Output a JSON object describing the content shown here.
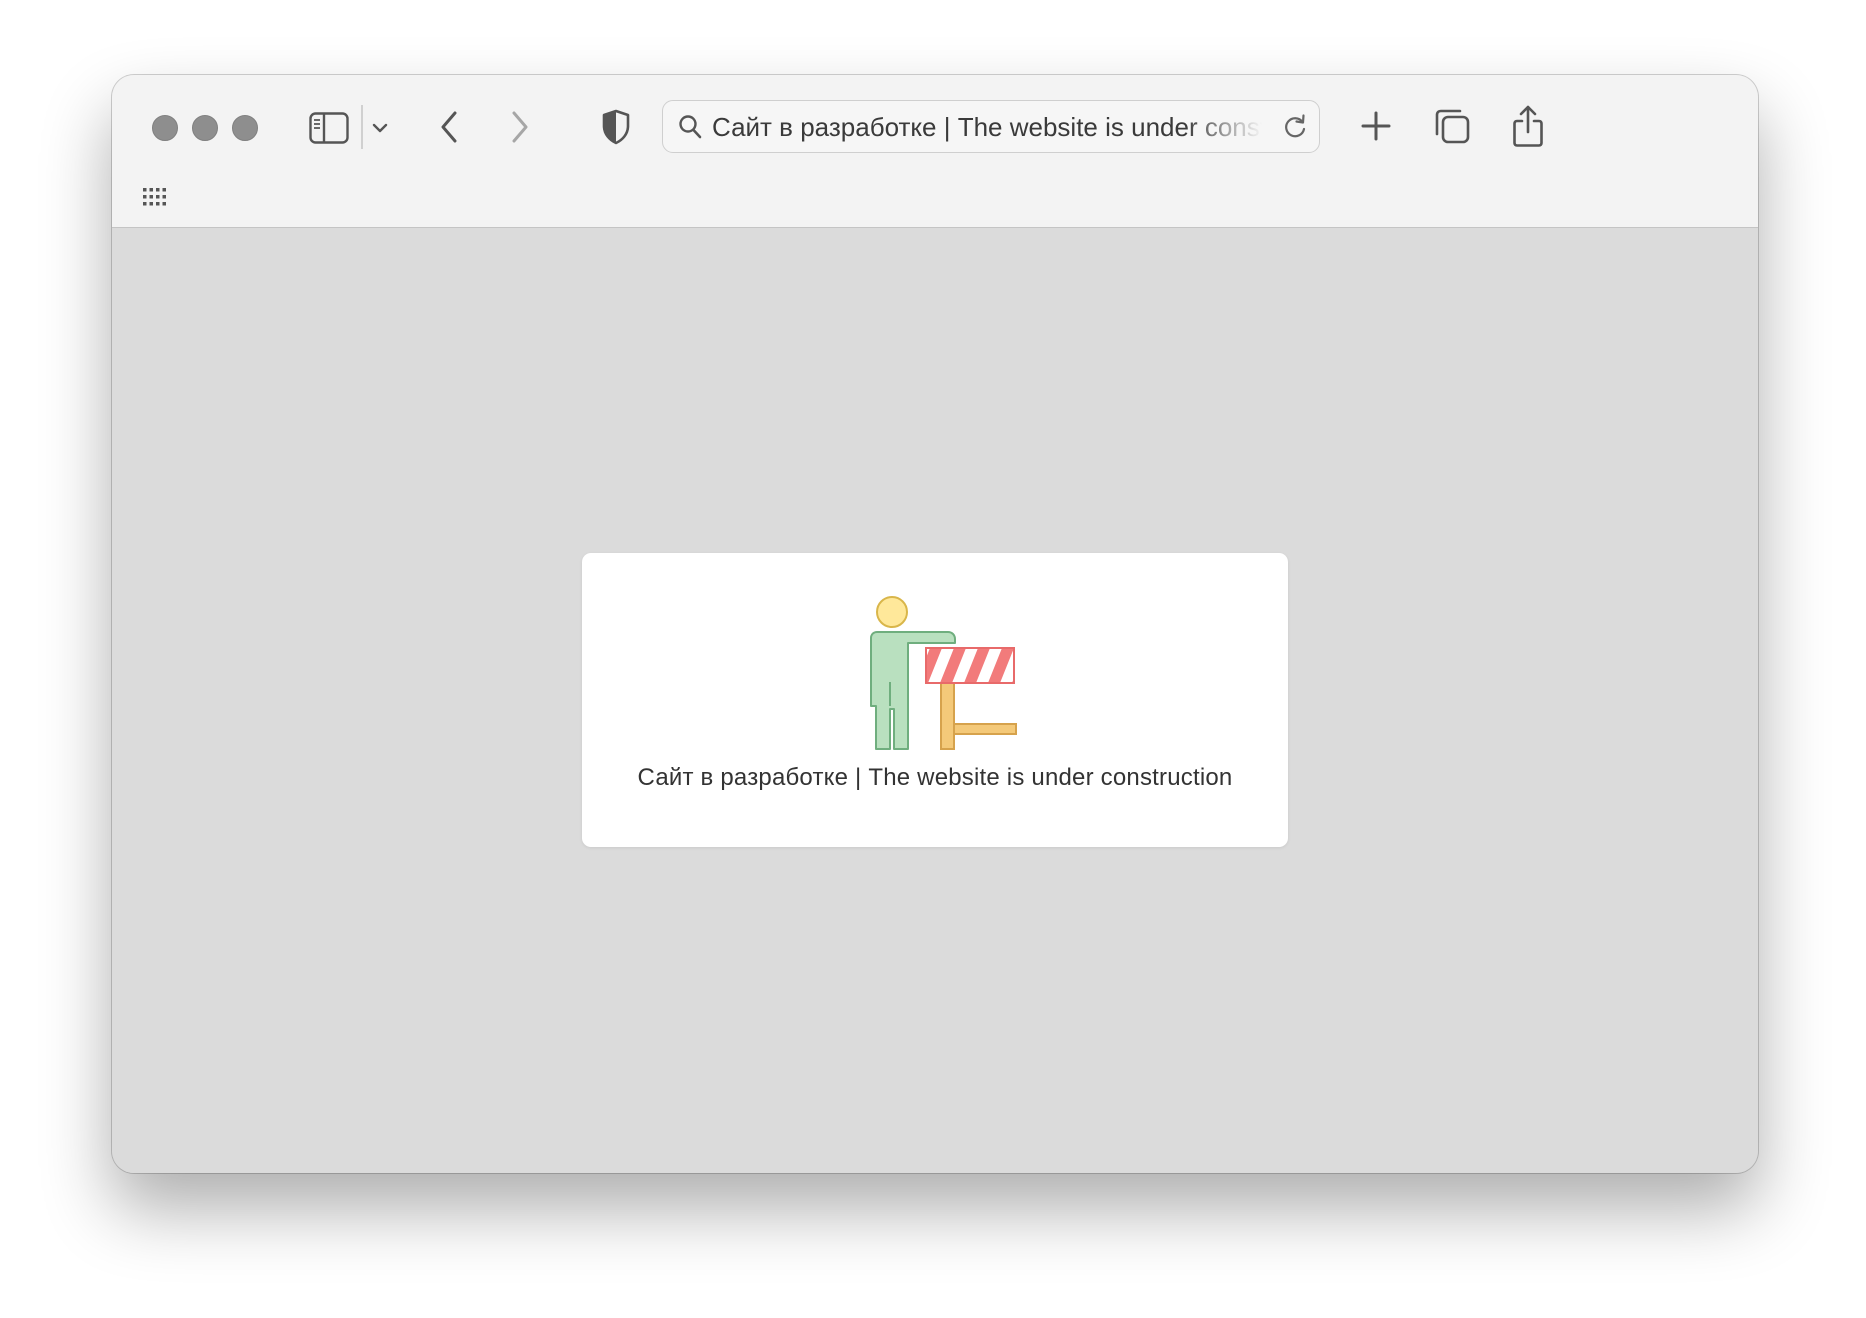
{
  "browser": {
    "address_bar": {
      "text": "Сайт в разработке | The website is under construction"
    },
    "icons": {
      "sidebar": "sidebar-icon",
      "sidebar_menu": "chevron-down-icon",
      "back": "chevron-left-icon",
      "forward": "chevron-right-icon",
      "privacy": "shield-icon",
      "search": "search-icon",
      "reload": "reload-icon",
      "new_tab": "plus-icon",
      "tab_overview": "tabs-overview-icon",
      "share": "share-icon",
      "favorites": "grid-icon"
    }
  },
  "page": {
    "message": "Сайт в разработке | The website is under construction",
    "illustration": "construction-worker-barrier-icon"
  },
  "colors": {
    "window_bg": "#dbdbdb",
    "toolbar_bg": "#f3f3f3",
    "card_bg": "#ffffff",
    "figure_fill": "#b9e0bf",
    "figure_stroke": "#6fae7e",
    "head_fill": "#ffe89a",
    "barrier_red": "#f27b7b",
    "barrier_leg": "#f4c979"
  }
}
